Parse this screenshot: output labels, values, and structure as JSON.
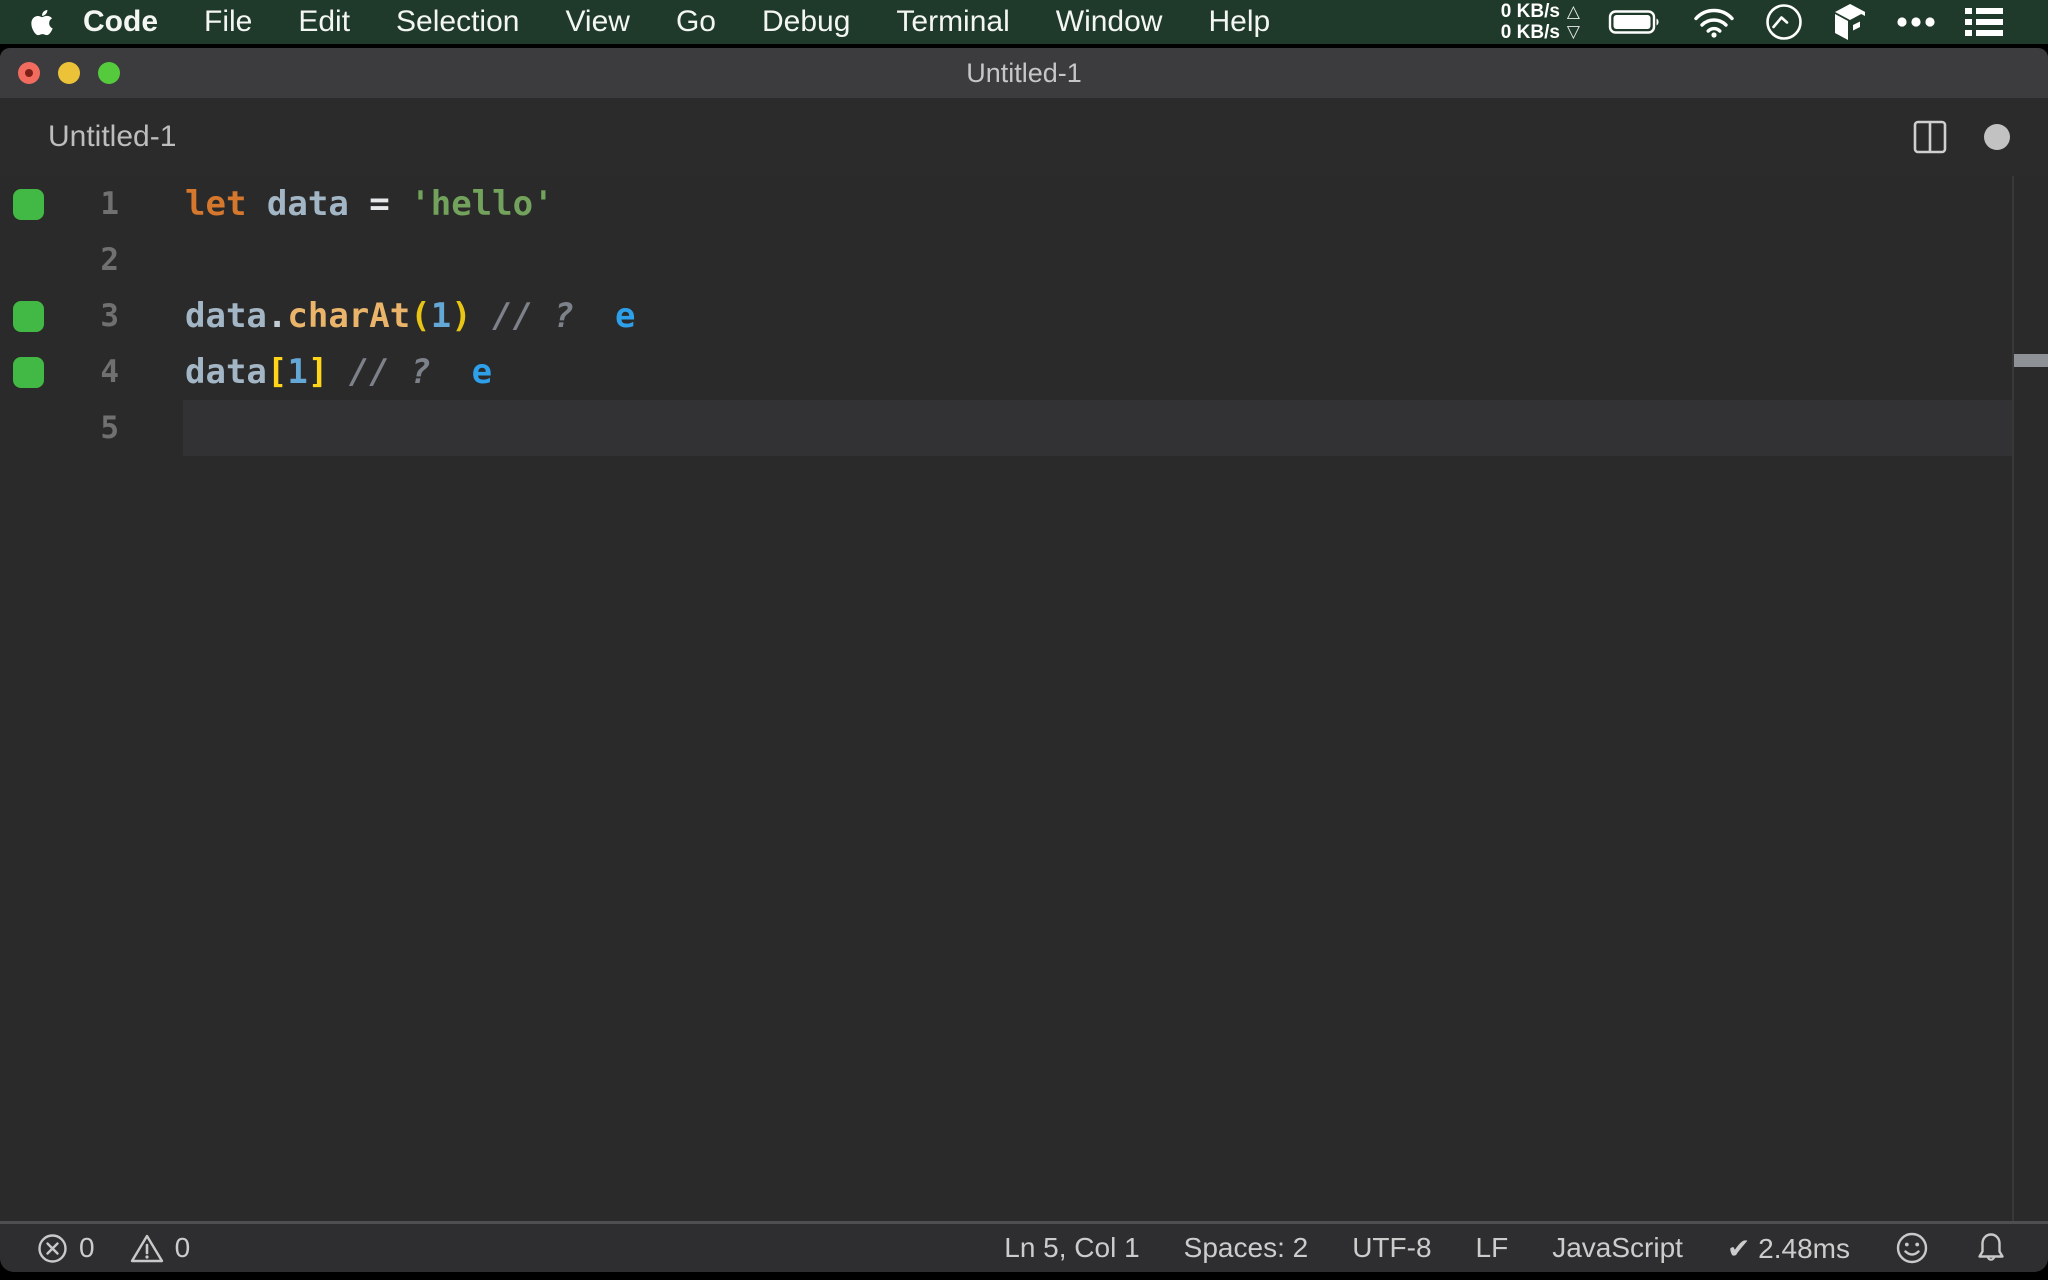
{
  "menubar": {
    "items": [
      {
        "label": "Code",
        "bold": true
      },
      {
        "label": "File"
      },
      {
        "label": "Edit"
      },
      {
        "label": "Selection"
      },
      {
        "label": "View"
      },
      {
        "label": "Go"
      },
      {
        "label": "Debug"
      },
      {
        "label": "Terminal"
      },
      {
        "label": "Window"
      },
      {
        "label": "Help"
      }
    ],
    "network_up": "0 KB/s",
    "network_down": "0 KB/s",
    "status_icons": [
      "battery-icon",
      "wifi-icon",
      "gauge-icon",
      "cube-icon",
      "ellipsis-icon",
      "list-icon"
    ],
    "bg_color": "#1f3a2a"
  },
  "window_title": "Untitled-1",
  "tab": {
    "label": "Untitled-1"
  },
  "editor": {
    "language_coloring": {
      "keyword": "#d5772c",
      "variable": "#a2b6c5",
      "operator": "#e6e8e9",
      "string": "#72a25b",
      "function": "#eab46a",
      "paren": "#e8c414",
      "bracket": "#ffd419",
      "number": "#64a8d8",
      "comment": "#7d828a",
      "quokka_result": "#2ea0ea",
      "quokka_marker": "#41b944"
    },
    "overview_mark_line": 4,
    "lines": [
      {
        "num": "1",
        "marker": true,
        "current": false,
        "tokens": [
          {
            "text": "let",
            "color": "#d5772c"
          },
          {
            "text": " ",
            "color": ""
          },
          {
            "text": "data",
            "color": "#a2b6c5"
          },
          {
            "text": " ",
            "color": ""
          },
          {
            "text": "=",
            "color": "#e6e8e9"
          },
          {
            "text": " ",
            "color": ""
          },
          {
            "text": "'hello'",
            "color": "#72a25b"
          }
        ]
      },
      {
        "num": "2",
        "marker": false,
        "current": false,
        "tokens": []
      },
      {
        "num": "3",
        "marker": true,
        "current": false,
        "tokens": [
          {
            "text": "data",
            "color": "#a2b6c5"
          },
          {
            "text": ".",
            "color": "#c3cdd6"
          },
          {
            "text": "charAt",
            "color": "#eab46a"
          },
          {
            "text": "(",
            "color": "#e8c414"
          },
          {
            "text": "1",
            "color": "#64a8d8"
          },
          {
            "text": ")",
            "color": "#e8c414"
          },
          {
            "text": " ",
            "color": ""
          },
          {
            "text": "// ?",
            "color": "#7d828a",
            "italic": true
          },
          {
            "text": "  ",
            "color": ""
          },
          {
            "text": "e",
            "color": "#2ea0ea"
          }
        ]
      },
      {
        "num": "4",
        "marker": true,
        "current": false,
        "tokens": [
          {
            "text": "data",
            "color": "#a2b6c5"
          },
          {
            "text": "[",
            "color": "#ffd419"
          },
          {
            "text": "1",
            "color": "#64a8d8"
          },
          {
            "text": "]",
            "color": "#ffd419"
          },
          {
            "text": " ",
            "color": ""
          },
          {
            "text": "// ?",
            "color": "#7d828a",
            "italic": true
          },
          {
            "text": "  ",
            "color": ""
          },
          {
            "text": "e",
            "color": "#2ea0ea"
          }
        ]
      },
      {
        "num": "5",
        "marker": false,
        "current": true,
        "tokens": []
      }
    ]
  },
  "statusbar": {
    "errors": "0",
    "warnings": "0",
    "items": [
      "Ln 5, Col 1",
      "Spaces: 2",
      "UTF-8",
      "LF",
      "JavaScript",
      "✔ 2.48ms"
    ]
  }
}
